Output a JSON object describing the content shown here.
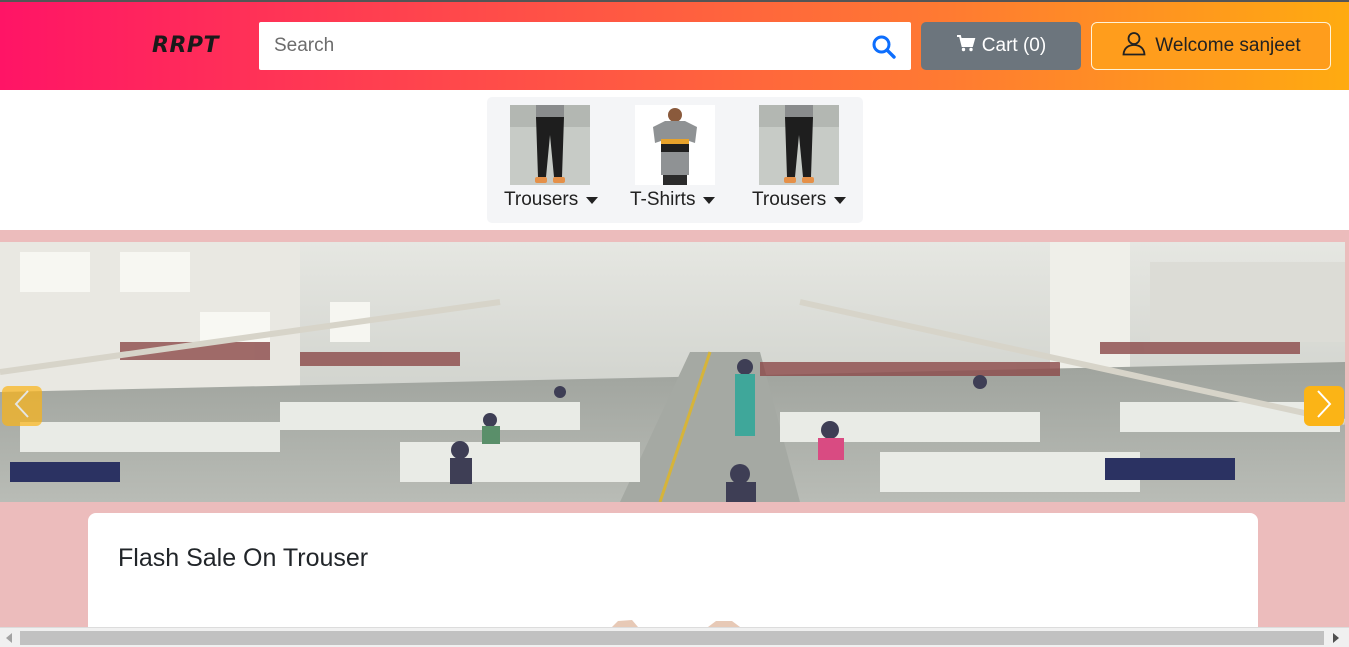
{
  "header": {
    "logo": "RRPT",
    "search_placeholder": "Search",
    "cart_label": "Cart (0)",
    "user_label": "Welcome sanjeet",
    "gradient_start": "#ff1466",
    "gradient_end": "#ffab10"
  },
  "categories": [
    {
      "label": "Trousers",
      "icon": "trousers-thumbnail"
    },
    {
      "label": "T-Shirts",
      "icon": "tshirt-thumbnail"
    },
    {
      "label": "Trousers",
      "icon": "trousers-thumbnail"
    }
  ],
  "carousel": {
    "image": "garment-factory-photo",
    "prev_icon": "chevron-left-icon",
    "next_icon": "chevron-right-icon",
    "accent": "#fbb416"
  },
  "section": {
    "title": "Flash Sale On Trouser",
    "background": "#ecbcbc"
  }
}
